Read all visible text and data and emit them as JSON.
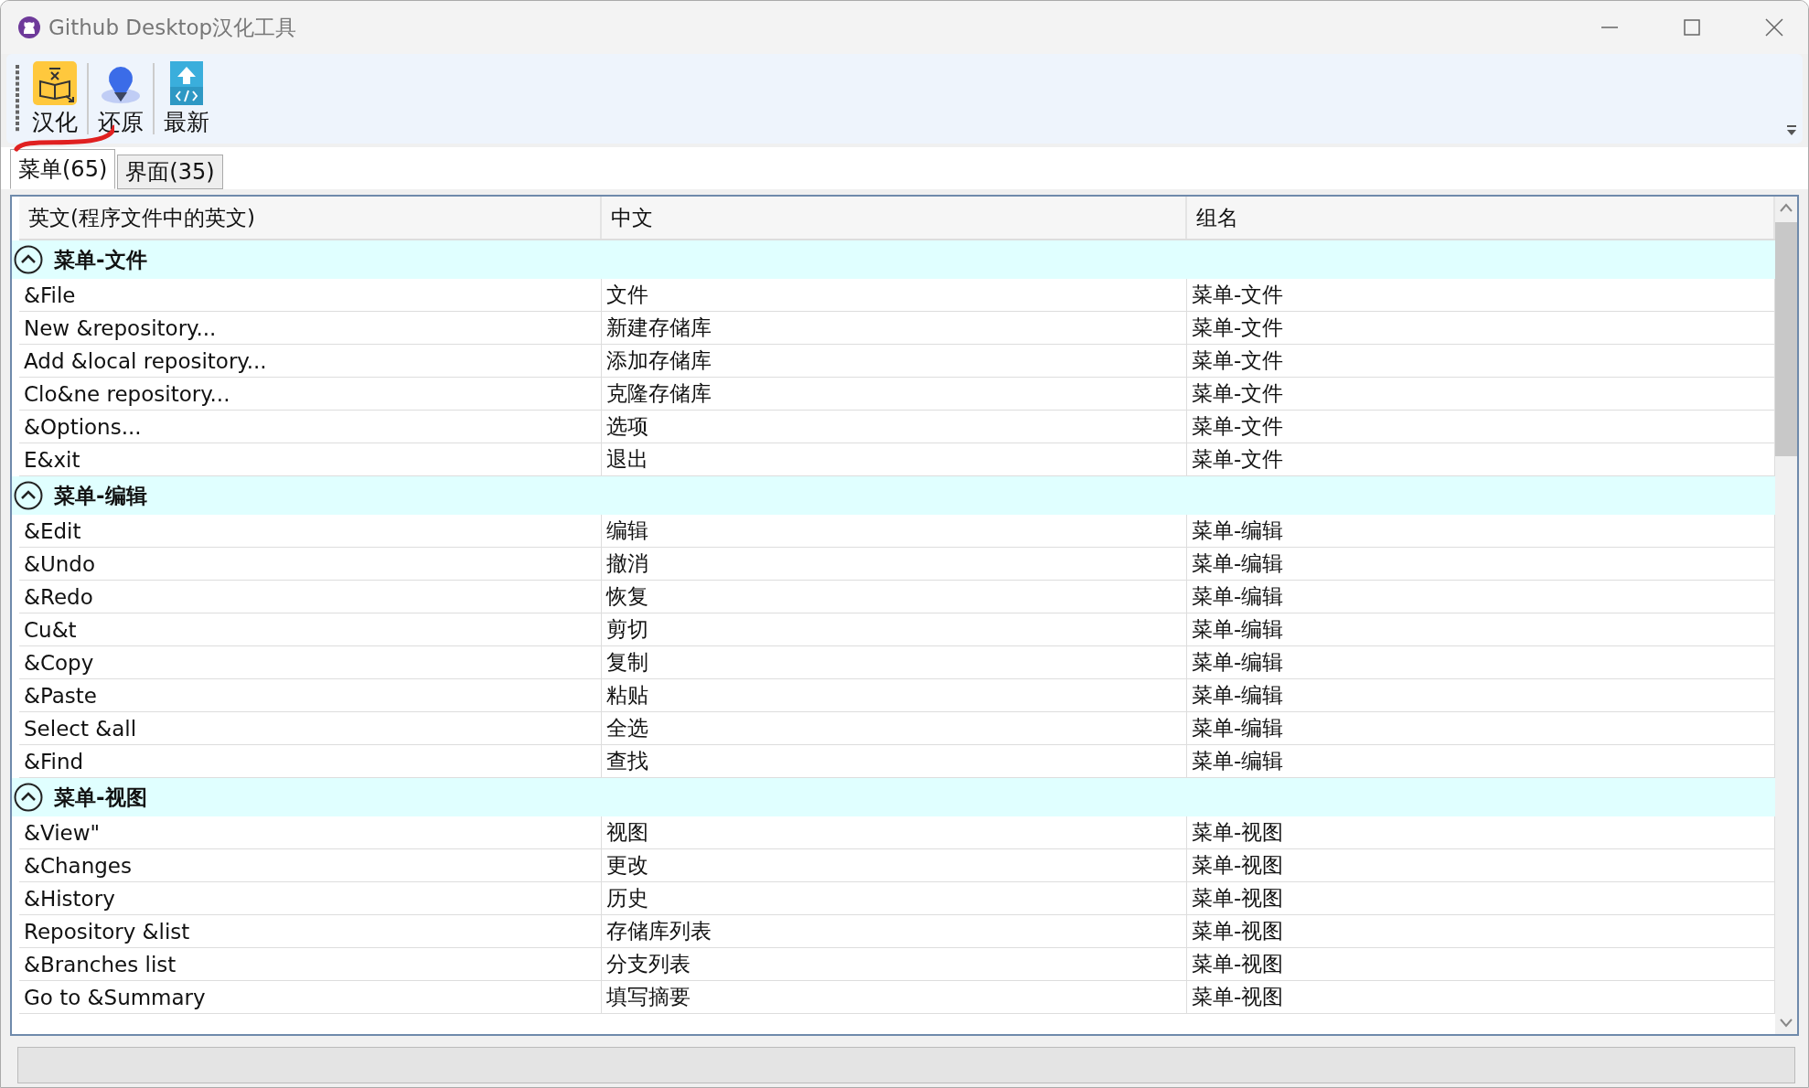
{
  "window": {
    "title": "Github Desktop汉化工具"
  },
  "toolbar": [
    {
      "label": "汉化",
      "kind": "translate"
    },
    {
      "label": "还原",
      "kind": "restore"
    },
    {
      "label": "最新",
      "kind": "update"
    }
  ],
  "tabs": [
    {
      "label": "菜单(65)",
      "selected": true
    },
    {
      "label": "界面(35)",
      "selected": false
    }
  ],
  "table": {
    "columns": [
      "英文(程序文件中的英文)",
      "中文",
      "组名"
    ],
    "groups": [
      {
        "title": "菜单-文件",
        "expanded": true,
        "rows": [
          [
            "&File",
            "文件",
            "菜单-文件"
          ],
          [
            "New &repository...",
            "新建存储库",
            "菜单-文件"
          ],
          [
            "Add &local repository...",
            "添加存储库",
            "菜单-文件"
          ],
          [
            "Clo&ne repository...",
            "克隆存储库",
            "菜单-文件"
          ],
          [
            "&Options...",
            "选项",
            "菜单-文件"
          ],
          [
            "E&xit",
            "退出",
            "菜单-文件"
          ]
        ]
      },
      {
        "title": "菜单-编辑",
        "expanded": true,
        "rows": [
          [
            "&Edit",
            "编辑",
            "菜单-编辑"
          ],
          [
            "&Undo",
            "撤消",
            "菜单-编辑"
          ],
          [
            "&Redo",
            "恢复",
            "菜单-编辑"
          ],
          [
            "Cu&t",
            "剪切",
            "菜单-编辑"
          ],
          [
            "&Copy",
            "复制",
            "菜单-编辑"
          ],
          [
            "&Paste",
            "粘贴",
            "菜单-编辑"
          ],
          [
            "Select &all",
            "全选",
            "菜单-编辑"
          ],
          [
            "&Find",
            "查找",
            "菜单-编辑"
          ]
        ]
      },
      {
        "title": "菜单-视图",
        "expanded": true,
        "rows": [
          [
            "&View\"",
            "视图",
            "菜单-视图"
          ],
          [
            "&Changes",
            "更改",
            "菜单-视图"
          ],
          [
            "&History",
            "历史",
            "菜单-视图"
          ],
          [
            "Repository &list",
            "存储库列表",
            "菜单-视图"
          ],
          [
            "&Branches list",
            "分支列表",
            "菜单-视图"
          ],
          [
            "Go to &Summary",
            "填写摘要",
            "菜单-视图"
          ]
        ]
      }
    ]
  }
}
